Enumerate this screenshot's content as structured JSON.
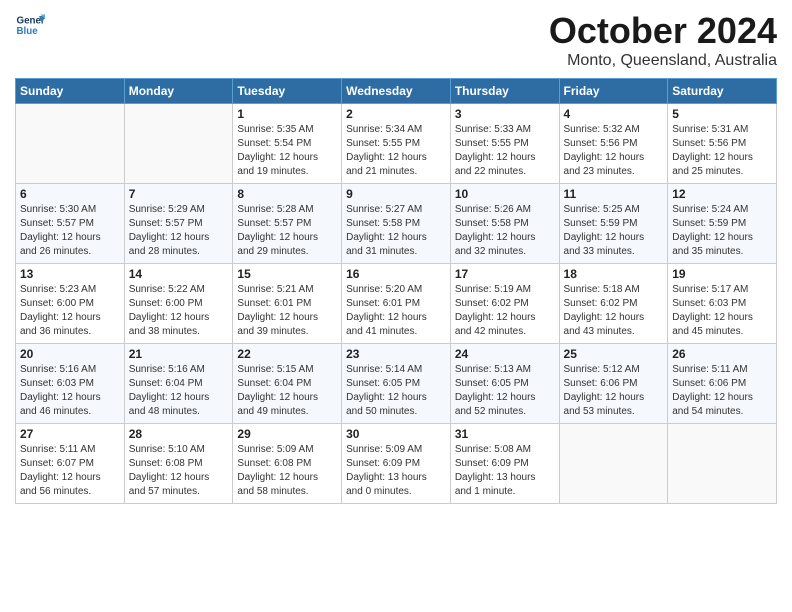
{
  "header": {
    "logo_line1": "General",
    "logo_line2": "Blue",
    "month": "October 2024",
    "location": "Monto, Queensland, Australia"
  },
  "weekdays": [
    "Sunday",
    "Monday",
    "Tuesday",
    "Wednesday",
    "Thursday",
    "Friday",
    "Saturday"
  ],
  "weeks": [
    [
      {
        "day": "",
        "sunrise": "",
        "sunset": "",
        "daylight": ""
      },
      {
        "day": "",
        "sunrise": "",
        "sunset": "",
        "daylight": ""
      },
      {
        "day": "1",
        "sunrise": "Sunrise: 5:35 AM",
        "sunset": "Sunset: 5:54 PM",
        "daylight": "Daylight: 12 hours and 19 minutes."
      },
      {
        "day": "2",
        "sunrise": "Sunrise: 5:34 AM",
        "sunset": "Sunset: 5:55 PM",
        "daylight": "Daylight: 12 hours and 21 minutes."
      },
      {
        "day": "3",
        "sunrise": "Sunrise: 5:33 AM",
        "sunset": "Sunset: 5:55 PM",
        "daylight": "Daylight: 12 hours and 22 minutes."
      },
      {
        "day": "4",
        "sunrise": "Sunrise: 5:32 AM",
        "sunset": "Sunset: 5:56 PM",
        "daylight": "Daylight: 12 hours and 23 minutes."
      },
      {
        "day": "5",
        "sunrise": "Sunrise: 5:31 AM",
        "sunset": "Sunset: 5:56 PM",
        "daylight": "Daylight: 12 hours and 25 minutes."
      }
    ],
    [
      {
        "day": "6",
        "sunrise": "Sunrise: 5:30 AM",
        "sunset": "Sunset: 5:57 PM",
        "daylight": "Daylight: 12 hours and 26 minutes."
      },
      {
        "day": "7",
        "sunrise": "Sunrise: 5:29 AM",
        "sunset": "Sunset: 5:57 PM",
        "daylight": "Daylight: 12 hours and 28 minutes."
      },
      {
        "day": "8",
        "sunrise": "Sunrise: 5:28 AM",
        "sunset": "Sunset: 5:57 PM",
        "daylight": "Daylight: 12 hours and 29 minutes."
      },
      {
        "day": "9",
        "sunrise": "Sunrise: 5:27 AM",
        "sunset": "Sunset: 5:58 PM",
        "daylight": "Daylight: 12 hours and 31 minutes."
      },
      {
        "day": "10",
        "sunrise": "Sunrise: 5:26 AM",
        "sunset": "Sunset: 5:58 PM",
        "daylight": "Daylight: 12 hours and 32 minutes."
      },
      {
        "day": "11",
        "sunrise": "Sunrise: 5:25 AM",
        "sunset": "Sunset: 5:59 PM",
        "daylight": "Daylight: 12 hours and 33 minutes."
      },
      {
        "day": "12",
        "sunrise": "Sunrise: 5:24 AM",
        "sunset": "Sunset: 5:59 PM",
        "daylight": "Daylight: 12 hours and 35 minutes."
      }
    ],
    [
      {
        "day": "13",
        "sunrise": "Sunrise: 5:23 AM",
        "sunset": "Sunset: 6:00 PM",
        "daylight": "Daylight: 12 hours and 36 minutes."
      },
      {
        "day": "14",
        "sunrise": "Sunrise: 5:22 AM",
        "sunset": "Sunset: 6:00 PM",
        "daylight": "Daylight: 12 hours and 38 minutes."
      },
      {
        "day": "15",
        "sunrise": "Sunrise: 5:21 AM",
        "sunset": "Sunset: 6:01 PM",
        "daylight": "Daylight: 12 hours and 39 minutes."
      },
      {
        "day": "16",
        "sunrise": "Sunrise: 5:20 AM",
        "sunset": "Sunset: 6:01 PM",
        "daylight": "Daylight: 12 hours and 41 minutes."
      },
      {
        "day": "17",
        "sunrise": "Sunrise: 5:19 AM",
        "sunset": "Sunset: 6:02 PM",
        "daylight": "Daylight: 12 hours and 42 minutes."
      },
      {
        "day": "18",
        "sunrise": "Sunrise: 5:18 AM",
        "sunset": "Sunset: 6:02 PM",
        "daylight": "Daylight: 12 hours and 43 minutes."
      },
      {
        "day": "19",
        "sunrise": "Sunrise: 5:17 AM",
        "sunset": "Sunset: 6:03 PM",
        "daylight": "Daylight: 12 hours and 45 minutes."
      }
    ],
    [
      {
        "day": "20",
        "sunrise": "Sunrise: 5:16 AM",
        "sunset": "Sunset: 6:03 PM",
        "daylight": "Daylight: 12 hours and 46 minutes."
      },
      {
        "day": "21",
        "sunrise": "Sunrise: 5:16 AM",
        "sunset": "Sunset: 6:04 PM",
        "daylight": "Daylight: 12 hours and 48 minutes."
      },
      {
        "day": "22",
        "sunrise": "Sunrise: 5:15 AM",
        "sunset": "Sunset: 6:04 PM",
        "daylight": "Daylight: 12 hours and 49 minutes."
      },
      {
        "day": "23",
        "sunrise": "Sunrise: 5:14 AM",
        "sunset": "Sunset: 6:05 PM",
        "daylight": "Daylight: 12 hours and 50 minutes."
      },
      {
        "day": "24",
        "sunrise": "Sunrise: 5:13 AM",
        "sunset": "Sunset: 6:05 PM",
        "daylight": "Daylight: 12 hours and 52 minutes."
      },
      {
        "day": "25",
        "sunrise": "Sunrise: 5:12 AM",
        "sunset": "Sunset: 6:06 PM",
        "daylight": "Daylight: 12 hours and 53 minutes."
      },
      {
        "day": "26",
        "sunrise": "Sunrise: 5:11 AM",
        "sunset": "Sunset: 6:06 PM",
        "daylight": "Daylight: 12 hours and 54 minutes."
      }
    ],
    [
      {
        "day": "27",
        "sunrise": "Sunrise: 5:11 AM",
        "sunset": "Sunset: 6:07 PM",
        "daylight": "Daylight: 12 hours and 56 minutes."
      },
      {
        "day": "28",
        "sunrise": "Sunrise: 5:10 AM",
        "sunset": "Sunset: 6:08 PM",
        "daylight": "Daylight: 12 hours and 57 minutes."
      },
      {
        "day": "29",
        "sunrise": "Sunrise: 5:09 AM",
        "sunset": "Sunset: 6:08 PM",
        "daylight": "Daylight: 12 hours and 58 minutes."
      },
      {
        "day": "30",
        "sunrise": "Sunrise: 5:09 AM",
        "sunset": "Sunset: 6:09 PM",
        "daylight": "Daylight: 13 hours and 0 minutes."
      },
      {
        "day": "31",
        "sunrise": "Sunrise: 5:08 AM",
        "sunset": "Sunset: 6:09 PM",
        "daylight": "Daylight: 13 hours and 1 minute."
      },
      {
        "day": "",
        "sunrise": "",
        "sunset": "",
        "daylight": ""
      },
      {
        "day": "",
        "sunrise": "",
        "sunset": "",
        "daylight": ""
      }
    ]
  ]
}
